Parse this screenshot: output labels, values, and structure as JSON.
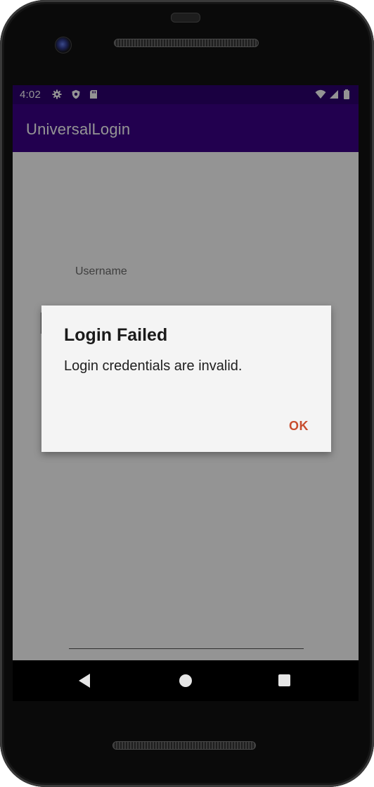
{
  "status_bar": {
    "time": "4:02",
    "icons_left": [
      "gear-icon",
      "shield-icon",
      "sd-card-icon"
    ],
    "icons_right": [
      "wifi-icon",
      "signal-icon",
      "battery-icon"
    ]
  },
  "app_bar": {
    "title": "UniversalLogin"
  },
  "form": {
    "username_label": "Username"
  },
  "dialog": {
    "title": "Login Failed",
    "message": "Login credentials are invalid.",
    "ok_label": "OK"
  },
  "colors": {
    "status_bar": "#2d0070",
    "app_bar": "#3c0089",
    "dialog_bg": "#f4f4f4",
    "accent": "#c84d2e"
  },
  "nav_bar": {
    "buttons": [
      "back",
      "home",
      "recents"
    ]
  }
}
